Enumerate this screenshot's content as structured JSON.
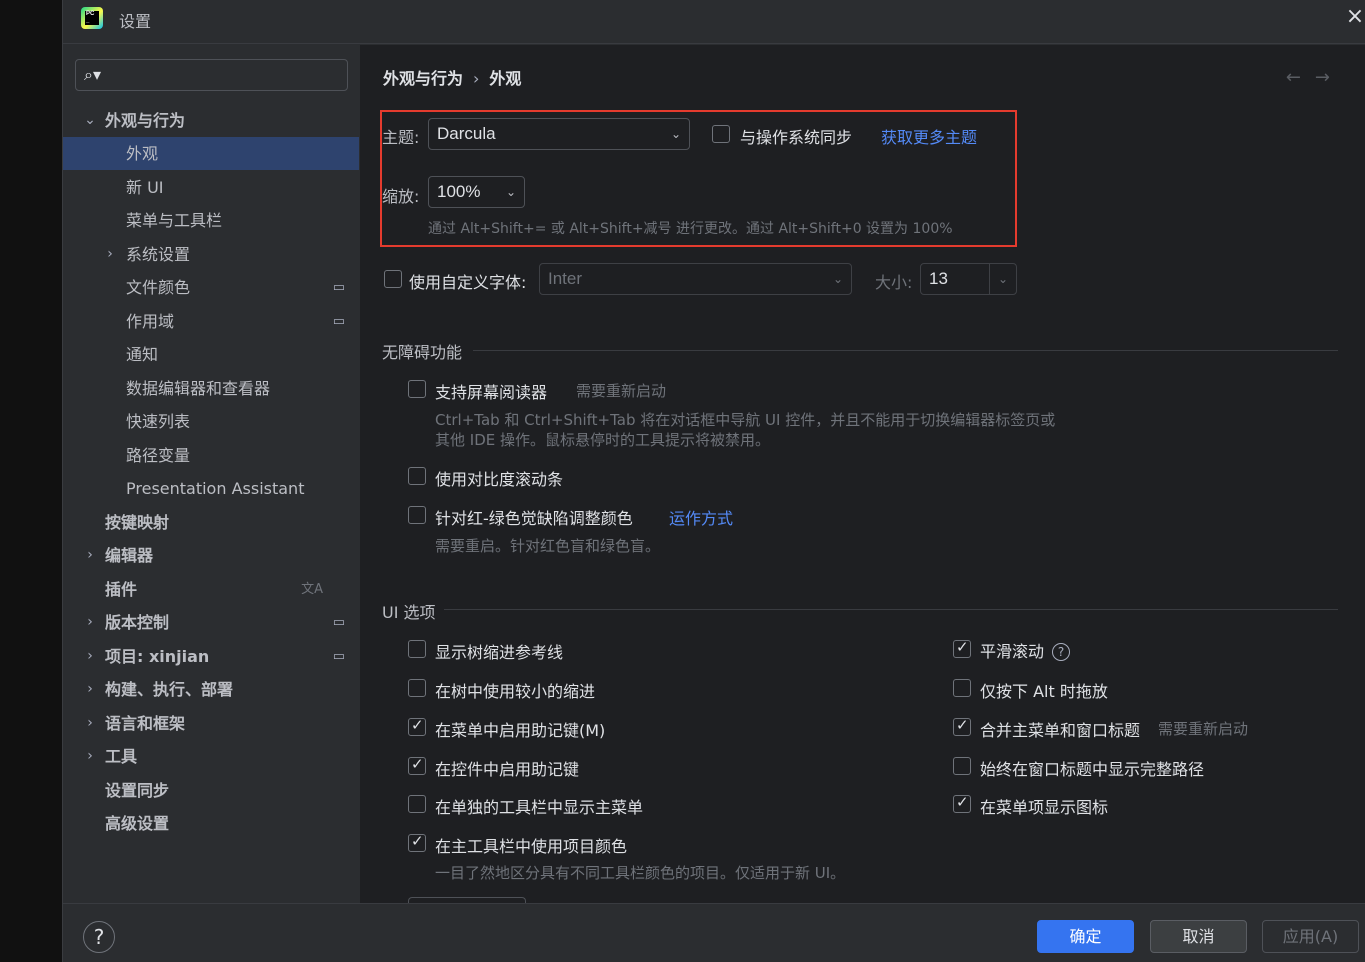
{
  "window": {
    "title": "设置",
    "close_icon": "×"
  },
  "search": {
    "placeholder": ""
  },
  "sidebar": {
    "items": [
      {
        "label": "外观与行为",
        "bold": true,
        "expanded": true
      },
      {
        "label": "外观"
      },
      {
        "label": "新 UI"
      },
      {
        "label": "菜单与工具栏"
      },
      {
        "label": "系统设置"
      },
      {
        "label": "文件颜色"
      },
      {
        "label": "作用域"
      },
      {
        "label": "通知"
      },
      {
        "label": "数据编辑器和查看器"
      },
      {
        "label": "快速列表"
      },
      {
        "label": "路径变量"
      },
      {
        "label": "Presentation Assistant"
      },
      {
        "label": "按键映射"
      },
      {
        "label": "编辑器"
      },
      {
        "label": "插件"
      },
      {
        "label": "版本控制"
      },
      {
        "label": "项目: xinjian"
      },
      {
        "label": "构建、执行、部署"
      },
      {
        "label": "语言和框架"
      },
      {
        "label": "工具"
      },
      {
        "label": "设置同步"
      },
      {
        "label": "高级设置"
      }
    ]
  },
  "breadcrumb": {
    "parent": "外观与行为",
    "separator": "›",
    "current": "外观",
    "back_icon": "←",
    "forward_icon": "→"
  },
  "theme": {
    "label": "主题:",
    "value": "Darcula",
    "sync_label": "与操作系统同步",
    "sync_checked": false,
    "more_link": "获取更多主题"
  },
  "zoom": {
    "label": "缩放:",
    "value": "100%",
    "hint": "通过 Alt+Shift+= 或 Alt+Shift+减号 进行更改。通过 Alt+Shift+0 设置为 100%"
  },
  "custom_font": {
    "label": "使用自定义字体:",
    "checked": false,
    "value": "Inter",
    "size_label": "大小:",
    "size_value": "13"
  },
  "accessibility": {
    "title": "无障碍功能",
    "screen_reader": {
      "label": "支持屏幕阅读器",
      "note": "需要重新启动",
      "checked": false,
      "desc1": "Ctrl+Tab 和 Ctrl+Shift+Tab 将在对话框中导航 UI 控件，并且不能用于切换编辑器标签页或",
      "desc2": "其他 IDE 操作。鼠标悬停时的工具提示将被禁用。"
    },
    "contrast_scroll": {
      "label": "使用对比度滚动条",
      "checked": false
    },
    "color_deficiency": {
      "label": "针对红-绿色觉缺陷调整颜色",
      "link": "运作方式",
      "checked": false,
      "desc": "需要重启。针对红色盲和绿色盲。"
    }
  },
  "ui_options": {
    "title": "UI 选项",
    "left": [
      {
        "label": "显示树缩进参考线",
        "checked": false
      },
      {
        "label": "在树中使用较小的缩进",
        "checked": false
      },
      {
        "label": "在菜单中启用助记键(M)",
        "checked": true
      },
      {
        "label": "在控件中启用助记键",
        "checked": true
      },
      {
        "label": "在单独的工具栏中显示主菜单",
        "checked": false
      },
      {
        "label": "在主工具栏中使用项目颜色",
        "checked": true
      }
    ],
    "right": [
      {
        "label": "平滑滚动",
        "checked": true,
        "help": "?"
      },
      {
        "label": "仅按下 Alt 时拖放",
        "checked": false
      },
      {
        "label": "合并主菜单和窗口标题",
        "note": "需要重新启动",
        "checked": true
      },
      {
        "label": "始终在窗口标题中显示完整路径",
        "checked": false
      },
      {
        "label": "在菜单项显示图标",
        "checked": true
      }
    ],
    "project_color_desc": "一目了然地区分具有不同工具栏颜色的项目。仅适用于新 UI。"
  },
  "footer": {
    "help": "?",
    "ok": "确定",
    "cancel": "取消",
    "apply": "应用(A)"
  },
  "colors": {
    "accent": "#3574f0",
    "selection": "#2e436e",
    "highlight_box": "#e53b2e",
    "link": "#548af7"
  }
}
